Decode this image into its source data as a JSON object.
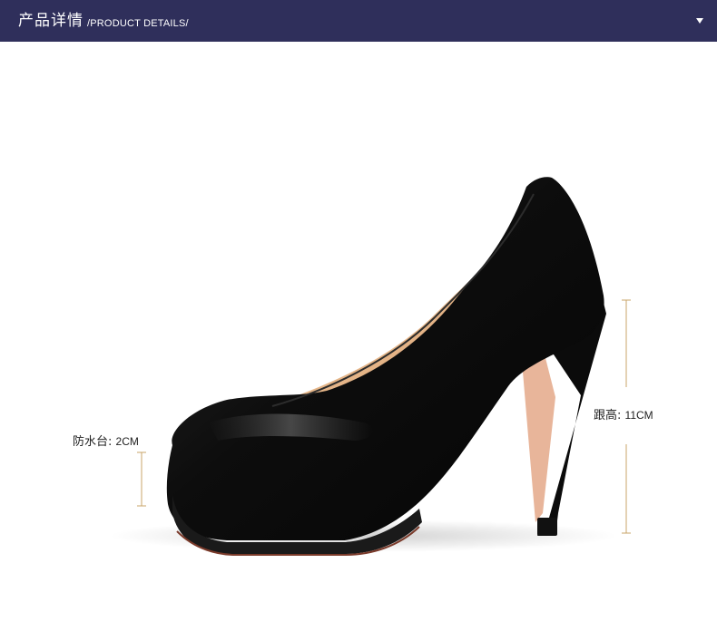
{
  "header": {
    "title_cn": "产品详情",
    "title_en": "/PRODUCT DETAILS/",
    "toggle_icon": "caret-down-icon"
  },
  "specs": {
    "platform": {
      "label": "防水台:",
      "value": "2CM"
    },
    "heel": {
      "label": "跟高:",
      "value": "11CM"
    }
  },
  "colors": {
    "header_bg": "#2f2f5b",
    "accent_line": "#c9a46a",
    "shoe": "#111111"
  }
}
